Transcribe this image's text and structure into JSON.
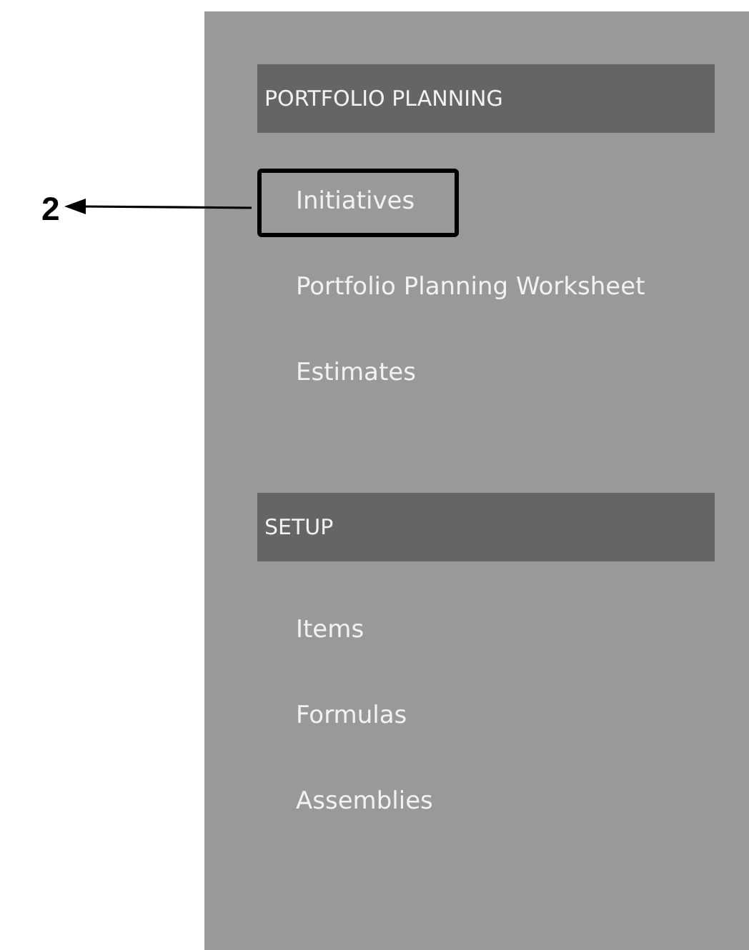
{
  "sections": [
    {
      "title": "PORTFOLIO PLANNING",
      "items": [
        {
          "label": "Initiatives",
          "highlighted": true
        },
        {
          "label": "Portfolio Planning Worksheet",
          "highlighted": false
        },
        {
          "label": "Estimates",
          "highlighted": false
        }
      ]
    },
    {
      "title": "SETUP",
      "items": [
        {
          "label": "Items",
          "highlighted": false
        },
        {
          "label": "Formulas",
          "highlighted": false
        },
        {
          "label": "Assemblies",
          "highlighted": false
        }
      ]
    }
  ],
  "callout": {
    "label": "2"
  }
}
